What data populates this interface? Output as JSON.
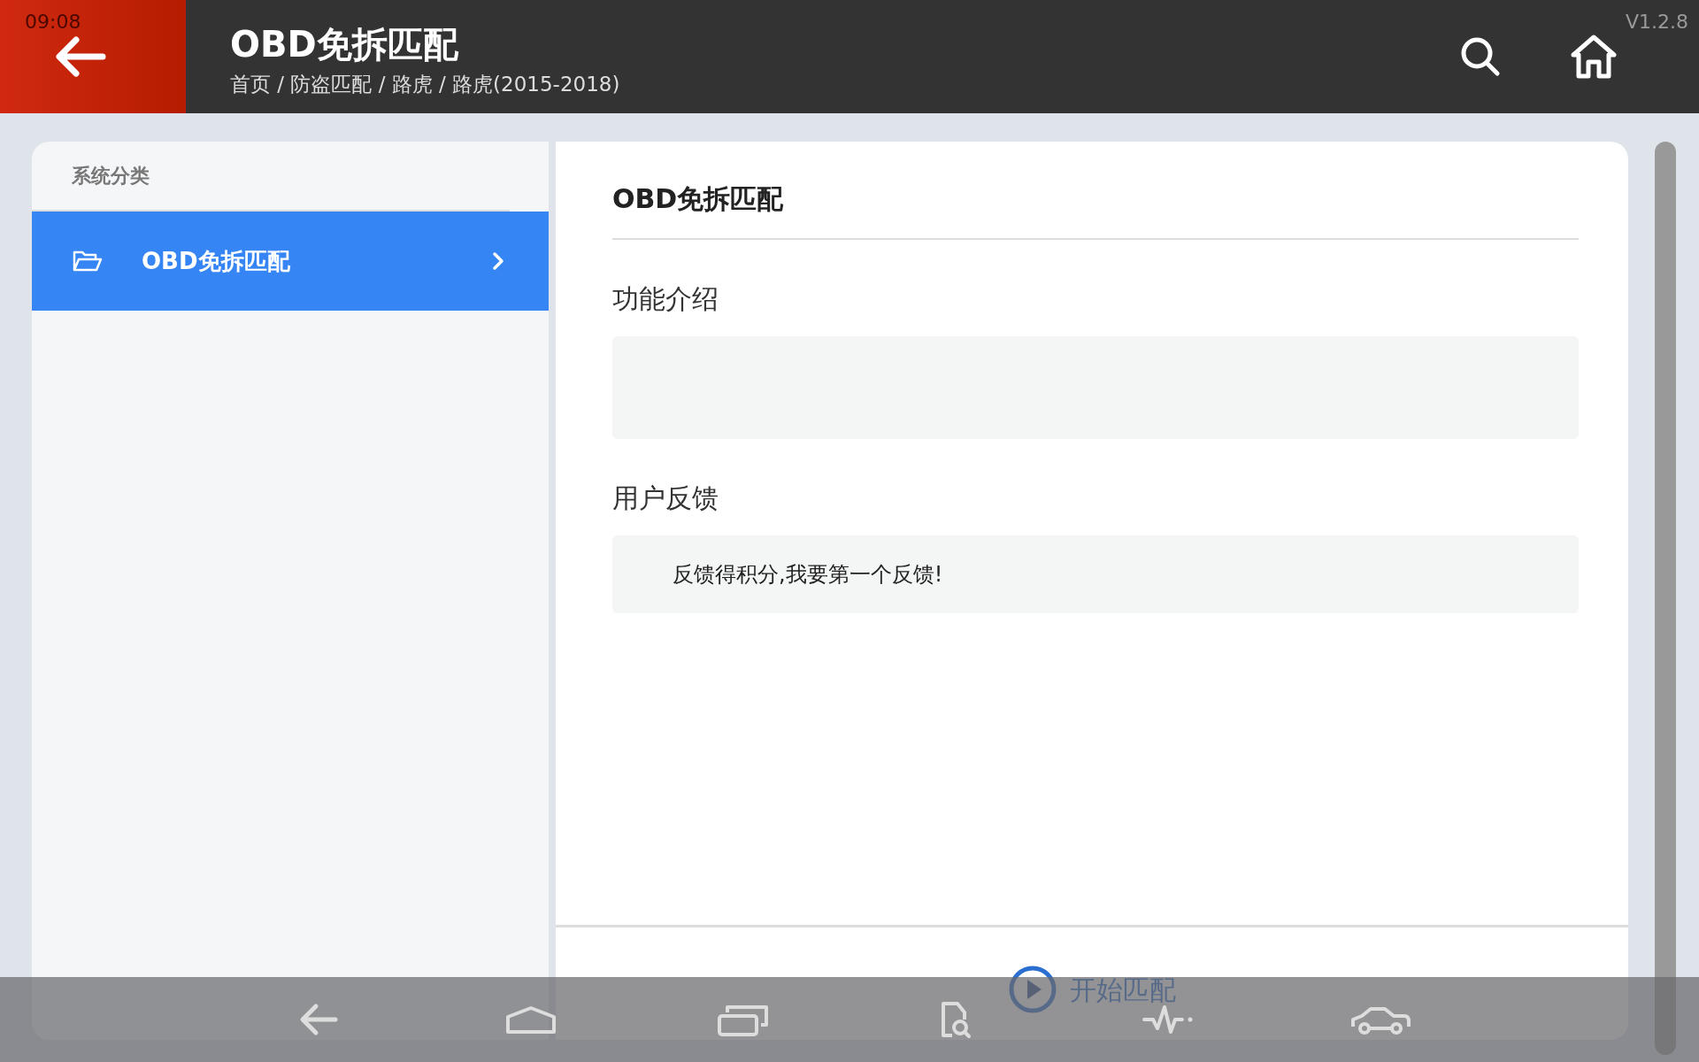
{
  "status_bar": {
    "time": "09:08",
    "version": "V1.2.8"
  },
  "header": {
    "title": "OBD免拆匹配",
    "breadcrumb": "首页 / 防盗匹配 / 路虎 / 路虎(2015-2018)"
  },
  "sidebar": {
    "heading": "系统分类",
    "items": [
      {
        "label": "OBD免拆匹配",
        "selected": true
      }
    ]
  },
  "content": {
    "title": "OBD免拆匹配",
    "sections": [
      {
        "kind": "empty",
        "heading": "功能介绍"
      },
      {
        "kind": "text",
        "heading": "用户反馈",
        "text": "反馈得积分,我要第一个反馈!"
      }
    ],
    "action": "开始匹配"
  }
}
